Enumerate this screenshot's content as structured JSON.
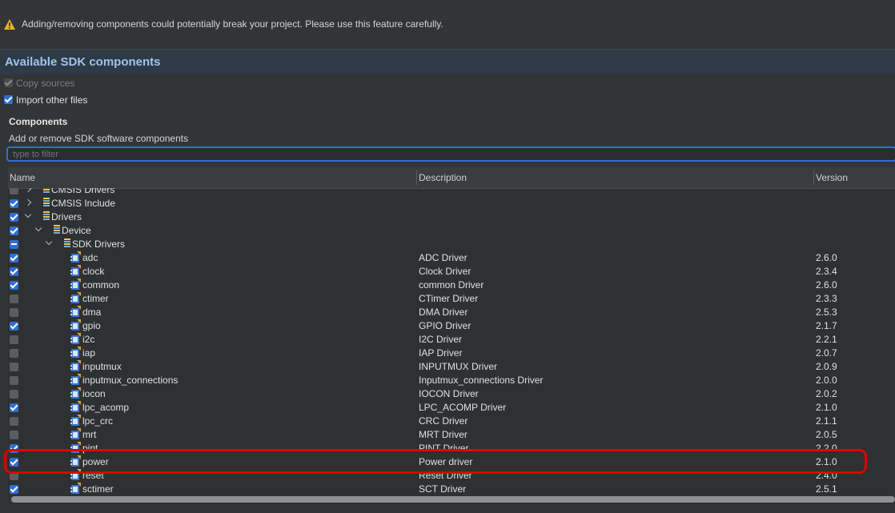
{
  "warning": {
    "text": "Adding/removing components could potentially break your project. Please use this feature carefully."
  },
  "section": {
    "title": "Available SDK components"
  },
  "options": {
    "copy_sources": {
      "label": "Copy sources",
      "checked": true,
      "disabled": true
    },
    "import_other": {
      "label": "Import other files",
      "checked": true
    }
  },
  "components": {
    "heading": "Components",
    "description": "Add or remove SDK software components",
    "filter_placeholder": "type to filter"
  },
  "table": {
    "columns": {
      "name": "Name",
      "description": "Description",
      "version": "Version"
    },
    "rows": [
      {
        "name": "CMSIS Drivers",
        "description": "",
        "version": "",
        "state": "off",
        "indent": 0,
        "expander": "right",
        "icon": "stack"
      },
      {
        "name": "CMSIS Include",
        "description": "",
        "version": "",
        "state": "on",
        "indent": 0,
        "expander": "right",
        "icon": "stack"
      },
      {
        "name": "Drivers",
        "description": "",
        "version": "",
        "state": "on",
        "indent": 0,
        "expander": "down",
        "icon": "stack"
      },
      {
        "name": "Device",
        "description": "",
        "version": "",
        "state": "on",
        "indent": 1,
        "expander": "down",
        "icon": "stack"
      },
      {
        "name": "SDK Drivers",
        "description": "",
        "version": "",
        "state": "mixed",
        "indent": 2,
        "expander": "down",
        "icon": "stack"
      },
      {
        "name": "adc",
        "description": "ADC Driver",
        "version": "2.6.0",
        "state": "on",
        "indent": 3,
        "icon": "component"
      },
      {
        "name": "clock",
        "description": "Clock Driver",
        "version": "2.3.4",
        "state": "on",
        "indent": 3,
        "icon": "component"
      },
      {
        "name": "common",
        "description": "common Driver",
        "version": "2.6.0",
        "state": "on",
        "indent": 3,
        "icon": "component"
      },
      {
        "name": "ctimer",
        "description": "CTimer Driver",
        "version": "2.3.3",
        "state": "off",
        "indent": 3,
        "icon": "component"
      },
      {
        "name": "dma",
        "description": "DMA Driver",
        "version": "2.5.3",
        "state": "off",
        "indent": 3,
        "icon": "component"
      },
      {
        "name": "gpio",
        "description": "GPIO Driver",
        "version": "2.1.7",
        "state": "on",
        "indent": 3,
        "icon": "component"
      },
      {
        "name": "i2c",
        "description": "I2C Driver",
        "version": "2.2.1",
        "state": "off",
        "indent": 3,
        "icon": "component"
      },
      {
        "name": "iap",
        "description": "IAP Driver",
        "version": "2.0.7",
        "state": "off",
        "indent": 3,
        "icon": "component"
      },
      {
        "name": "inputmux",
        "description": "INPUTMUX Driver",
        "version": "2.0.9",
        "state": "off",
        "indent": 3,
        "icon": "component"
      },
      {
        "name": "inputmux_connections",
        "description": "Inputmux_connections Driver",
        "version": "2.0.0",
        "state": "off",
        "indent": 3,
        "icon": "component"
      },
      {
        "name": "iocon",
        "description": "IOCON Driver",
        "version": "2.0.2",
        "state": "off",
        "indent": 3,
        "icon": "component"
      },
      {
        "name": "lpc_acomp",
        "description": "LPC_ACOMP Driver",
        "version": "2.1.0",
        "state": "on",
        "indent": 3,
        "icon": "component"
      },
      {
        "name": "lpc_crc",
        "description": "CRC Driver",
        "version": "2.1.1",
        "state": "off",
        "indent": 3,
        "icon": "component"
      },
      {
        "name": "mrt",
        "description": "MRT Driver",
        "version": "2.0.5",
        "state": "off",
        "indent": 3,
        "icon": "component"
      },
      {
        "name": "pint",
        "description": "PINT Driver",
        "version": "2.2.0",
        "state": "on",
        "indent": 3,
        "icon": "component"
      },
      {
        "name": "power",
        "description": "Power driver",
        "version": "2.1.0",
        "state": "on",
        "indent": 3,
        "icon": "component"
      },
      {
        "name": "reset",
        "description": "Reset Driver",
        "version": "2.4.0",
        "state": "off",
        "indent": 3,
        "icon": "component"
      },
      {
        "name": "sctimer",
        "description": "SCT Driver",
        "version": "2.5.1",
        "state": "on",
        "indent": 3,
        "icon": "component"
      }
    ]
  },
  "colors": {
    "accent": "#2f6fd6",
    "highlight": "#e00000",
    "section_title": "#9ec4ea"
  }
}
